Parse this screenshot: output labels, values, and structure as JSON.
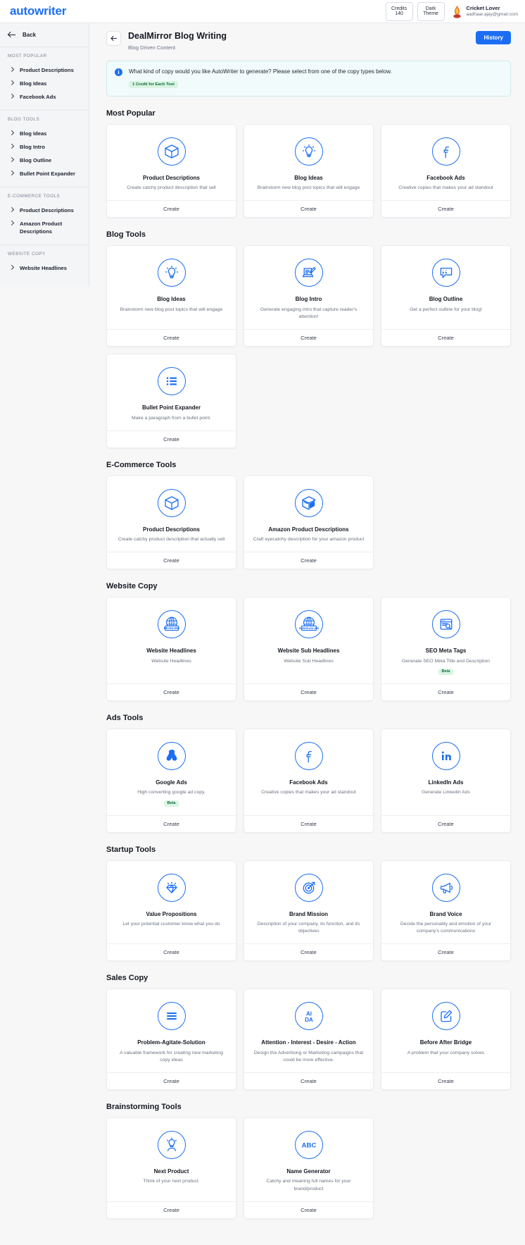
{
  "topbar": {
    "brand": "autowriter",
    "credits_label": "Credits",
    "credits_value": "140",
    "theme_label_1": "Dark",
    "theme_label_2": "Theme",
    "user_name": "Cricket Lover",
    "user_email": "aadhaar.ajay@gmail.com"
  },
  "sidebar": {
    "back_label": "Back",
    "groups": [
      {
        "heading": "MOST POPULAR",
        "items": [
          "Product Descriptions",
          "Blog Ideas",
          "Facebook Ads"
        ]
      },
      {
        "heading": "BLOG TOOLS",
        "items": [
          "Blog Ideas",
          "Blog Intro",
          "Blog Outline",
          "Bullet Point Expander"
        ]
      },
      {
        "heading": "E-COMMERCE TOOLS",
        "items": [
          "Product Descriptions",
          "Amazon Product Descriptions"
        ]
      },
      {
        "heading": "WEBSITE COPY",
        "items": [
          "Website Headlines"
        ]
      }
    ]
  },
  "header": {
    "title": "DealMirror Blog Writing",
    "subtitle": "Blog Driven Content",
    "history_label": "History"
  },
  "notice": {
    "text": "What kind of copy would you like AutoWriter to generate? Please select from one of the copy types below.",
    "credit_tag": "1 Credit for Each Tool"
  },
  "create_label": "Create",
  "beta_label": "Beta",
  "sections": [
    {
      "title": "Most Popular",
      "cards": [
        {
          "icon": "box-icon",
          "title": "Product Descriptions",
          "desc": "Create catchy product description that sell",
          "beta": false
        },
        {
          "icon": "lightbulb-icon",
          "title": "Blog Ideas",
          "desc": "Brainstorm new blog post topics that will engage",
          "beta": false
        },
        {
          "icon": "facebook-icon",
          "title": "Facebook Ads",
          "desc": "Creative copies that makes your ad standout",
          "beta": false
        }
      ]
    },
    {
      "title": "Blog Tools",
      "cards": [
        {
          "icon": "lightbulb-icon",
          "title": "Blog Ideas",
          "desc": "Brainstorm new blog post topics that will engage",
          "beta": false
        },
        {
          "icon": "laptop-pencil-icon",
          "title": "Blog Intro",
          "desc": "Generate engaging intro that capture reader's attention!",
          "beta": false
        },
        {
          "icon": "quote-icon",
          "title": "Blog Outline",
          "desc": "Get a perfect outline for your blog!",
          "beta": false
        },
        {
          "icon": "bullet-list-icon",
          "title": "Bullet Point Expander",
          "desc": "Make a paragraph from a bullet point.",
          "beta": false
        }
      ]
    },
    {
      "title": "E-Commerce Tools",
      "cards": [
        {
          "icon": "box-icon",
          "title": "Product Descriptions",
          "desc": "Create catchy product description that actually sell",
          "beta": false
        },
        {
          "icon": "amazon-box-icon",
          "title": "Amazon Product Descriptions",
          "desc": "Craft eyecatchy description for your amazon product",
          "beta": false
        }
      ]
    },
    {
      "title": "Website Copy",
      "cards": [
        {
          "icon": "globe-headline-icon",
          "title": "Website Headlines",
          "desc": "Website Headlines",
          "beta": false
        },
        {
          "icon": "globe-subheadline-icon",
          "title": "Website Sub Headlines",
          "desc": "Website Sub Headlines",
          "beta": false
        },
        {
          "icon": "seo-page-icon",
          "title": "SEO Meta Tags",
          "desc": "Generate SEO Meta Title and Description",
          "beta": true
        }
      ]
    },
    {
      "title": "Ads Tools",
      "cards": [
        {
          "icon": "google-ads-icon",
          "title": "Google Ads",
          "desc": "High converting google ad copy.",
          "beta": true
        },
        {
          "icon": "facebook-icon",
          "title": "Facebook Ads",
          "desc": "Creative copies that makes your ad standout",
          "beta": false
        },
        {
          "icon": "linkedin-icon",
          "title": "LinkedIn Ads",
          "desc": "Generate Linkedin Ads",
          "beta": false
        }
      ]
    },
    {
      "title": "Startup Tools",
      "cards": [
        {
          "icon": "diamond-box-icon",
          "title": "Value Propositions",
          "desc": "Let your potential customer know what you do",
          "beta": false
        },
        {
          "icon": "target-arrow-icon",
          "title": "Brand Mission",
          "desc": "Description of your company, its function, and its objectives",
          "beta": false
        },
        {
          "icon": "megaphone-icon",
          "title": "Brand Voice",
          "desc": "Decide the personality and emotion of your company's communications",
          "beta": false
        }
      ]
    },
    {
      "title": "Sales Copy",
      "cards": [
        {
          "icon": "stacked-lines-icon",
          "title": "Problem-Agitate-Solution",
          "desc": "A valuable framework for creating new marketing copy ideas",
          "beta": false
        },
        {
          "icon": "aida-icon",
          "title": "Attention - Interest - Desire - Action",
          "desc": "Design the Advertising or Marketing campaigns that could be more effective.",
          "beta": false
        },
        {
          "icon": "pencil-square-icon",
          "title": "Before After Bridge",
          "desc": "A problem that your company solves",
          "beta": false
        }
      ]
    },
    {
      "title": "Brainstorming Tools",
      "cards": [
        {
          "icon": "idea-person-icon",
          "title": "Next Product",
          "desc": "Think of your next product.",
          "beta": false
        },
        {
          "icon": "abc-icon",
          "title": "Name Generator",
          "desc": "Catchy and meaning full names for your brand/product",
          "beta": false
        }
      ]
    }
  ]
}
